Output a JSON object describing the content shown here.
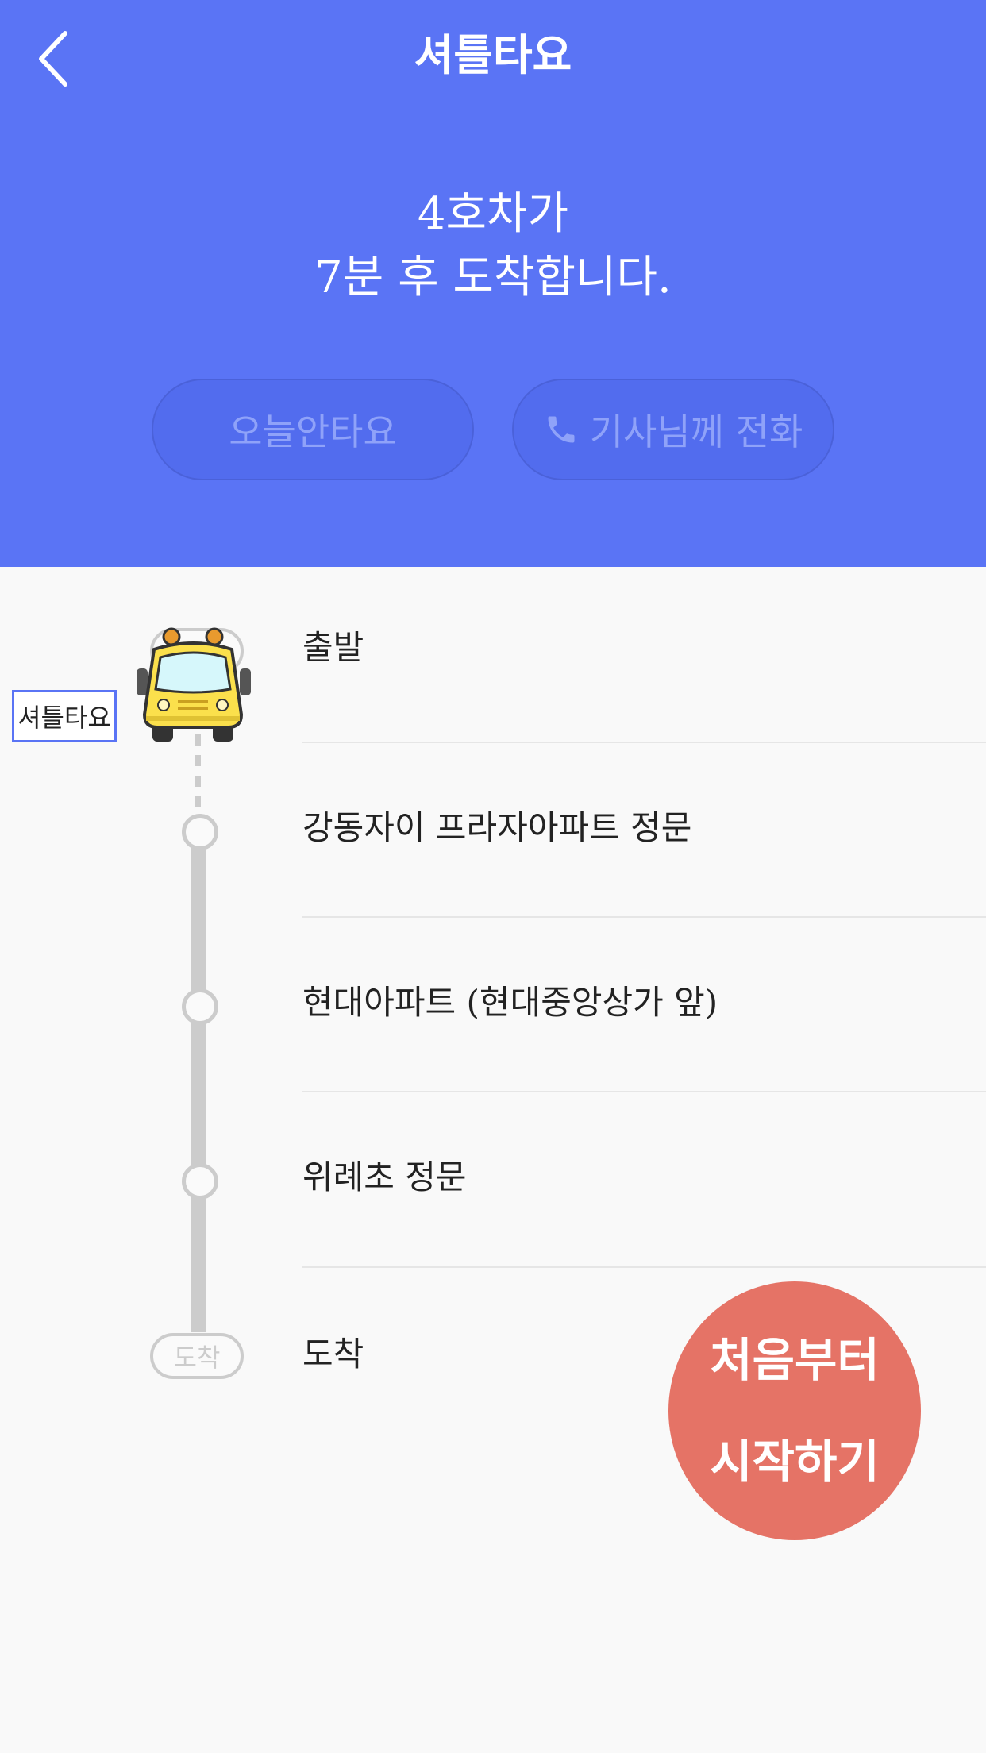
{
  "header": {
    "title": "셔틀타요",
    "arrival_line1": "4호차가",
    "arrival_line2": "7분 후 도착합니다.",
    "skip_today_label": "오늘안타요",
    "call_driver_label": "기사님께 전화"
  },
  "route": {
    "bus_tag": "셔틀타요",
    "start_node_label": "",
    "end_node_label": "도착",
    "stops": [
      {
        "label": "출발"
      },
      {
        "label": "강동자이 프라자아파트 정문"
      },
      {
        "label": "현대아파트 (현대중앙상가 앞)"
      },
      {
        "label": "위례초 정문"
      },
      {
        "label": "도착"
      }
    ]
  },
  "restart": {
    "line1": "처음부터",
    "line2": "시작하기"
  },
  "colors": {
    "header_bg": "#5a74f5",
    "restart_bg": "#e57366",
    "route_line": "#cccccc"
  },
  "icons": [
    "back-chevron-icon",
    "phone-icon",
    "bus-icon"
  ]
}
